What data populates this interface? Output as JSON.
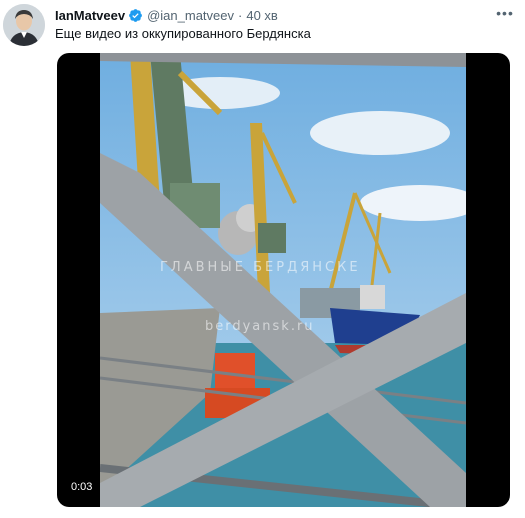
{
  "author": {
    "display_name": "IanMatveev",
    "handle": "@ian_matveev",
    "time_ago": "40 хв",
    "avatar_icon": "person-avatar",
    "verified_icon": "verified-badge-icon"
  },
  "tweet": {
    "text": "Еще видео из оккупированного Бердянска",
    "more_icon": "more-options-icon"
  },
  "video": {
    "timestamp": "0:03",
    "watermark_top": "ГЛАВНЫЕ БЕРДЯНСКЕ",
    "watermark_bottom": "berdyansk.ru"
  },
  "colors": {
    "verified": "#1d9bf0",
    "text": "#0f1419",
    "secondary": "#536471",
    "ship_hull": "#1f3f8f",
    "tug": "#e0502a",
    "sky": "#8fc0e6"
  }
}
